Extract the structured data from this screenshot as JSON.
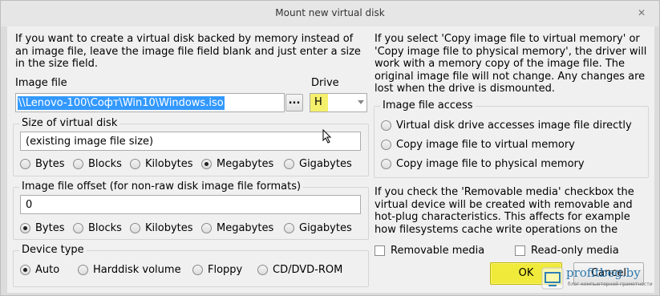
{
  "window": {
    "title": "Mount new virtual disk",
    "close_glyph": "✕"
  },
  "intro_text": "If you want to create a virtual disk backed by memory instead of an image file, leave the image file field blank and just enter a size in the size field.",
  "image_file": {
    "label": "Image file",
    "value": "\\\\Lenovo-100\\Софт\\Win10\\Windows.iso",
    "browse_label": "..."
  },
  "drive": {
    "label": "Drive",
    "value": "H"
  },
  "size_group": {
    "title": "Size of virtual disk",
    "value": "(existing image file size)",
    "units": [
      {
        "label": "Bytes",
        "selected": false
      },
      {
        "label": "Blocks",
        "selected": false
      },
      {
        "label": "Kilobytes",
        "selected": false
      },
      {
        "label": "Megabytes",
        "selected": true
      },
      {
        "label": "Gigabytes",
        "selected": false
      }
    ]
  },
  "offset_group": {
    "title": "Image file offset (for non-raw disk image file formats)",
    "value": "0",
    "units": [
      {
        "label": "Bytes",
        "selected": true
      },
      {
        "label": "Blocks",
        "selected": false
      },
      {
        "label": "Kilobytes",
        "selected": false
      },
      {
        "label": "Megabytes",
        "selected": false
      },
      {
        "label": "Gigabytes",
        "selected": false
      }
    ]
  },
  "device_group": {
    "title": "Device type",
    "options": [
      {
        "label": "Auto",
        "selected": true
      },
      {
        "label": "Harddisk volume",
        "selected": false
      },
      {
        "label": "Floppy",
        "selected": false
      },
      {
        "label": "CD/DVD-ROM",
        "selected": false
      }
    ]
  },
  "copy_text": "If you select 'Copy image file to virtual memory' or 'Copy image file to physical memory', the driver will work with a memory copy of the image file. The original image file will not change. Any changes are lost when the drive is dismounted.",
  "access_group": {
    "title": "Image file access",
    "options": [
      {
        "label": "Virtual disk drive accesses image file directly",
        "selected": false
      },
      {
        "label": "Copy image file to virtual memory",
        "selected": false
      },
      {
        "label": "Copy image file to physical memory",
        "selected": false
      }
    ]
  },
  "removable_text": "If you check the 'Removable media' checkbox the virtual device will be created with removable and hot-plug characteristics. This affects for example how filesystems cache write operations on the",
  "removable_check": {
    "label": "Removable media",
    "checked": false
  },
  "readonly_check": {
    "label": "Read-only media",
    "checked": false
  },
  "buttons": {
    "ok": "OK",
    "cancel": "Cancel"
  },
  "watermark": {
    "brand": "profitbeg.by",
    "tagline": "блог компьютерной грамотности"
  }
}
